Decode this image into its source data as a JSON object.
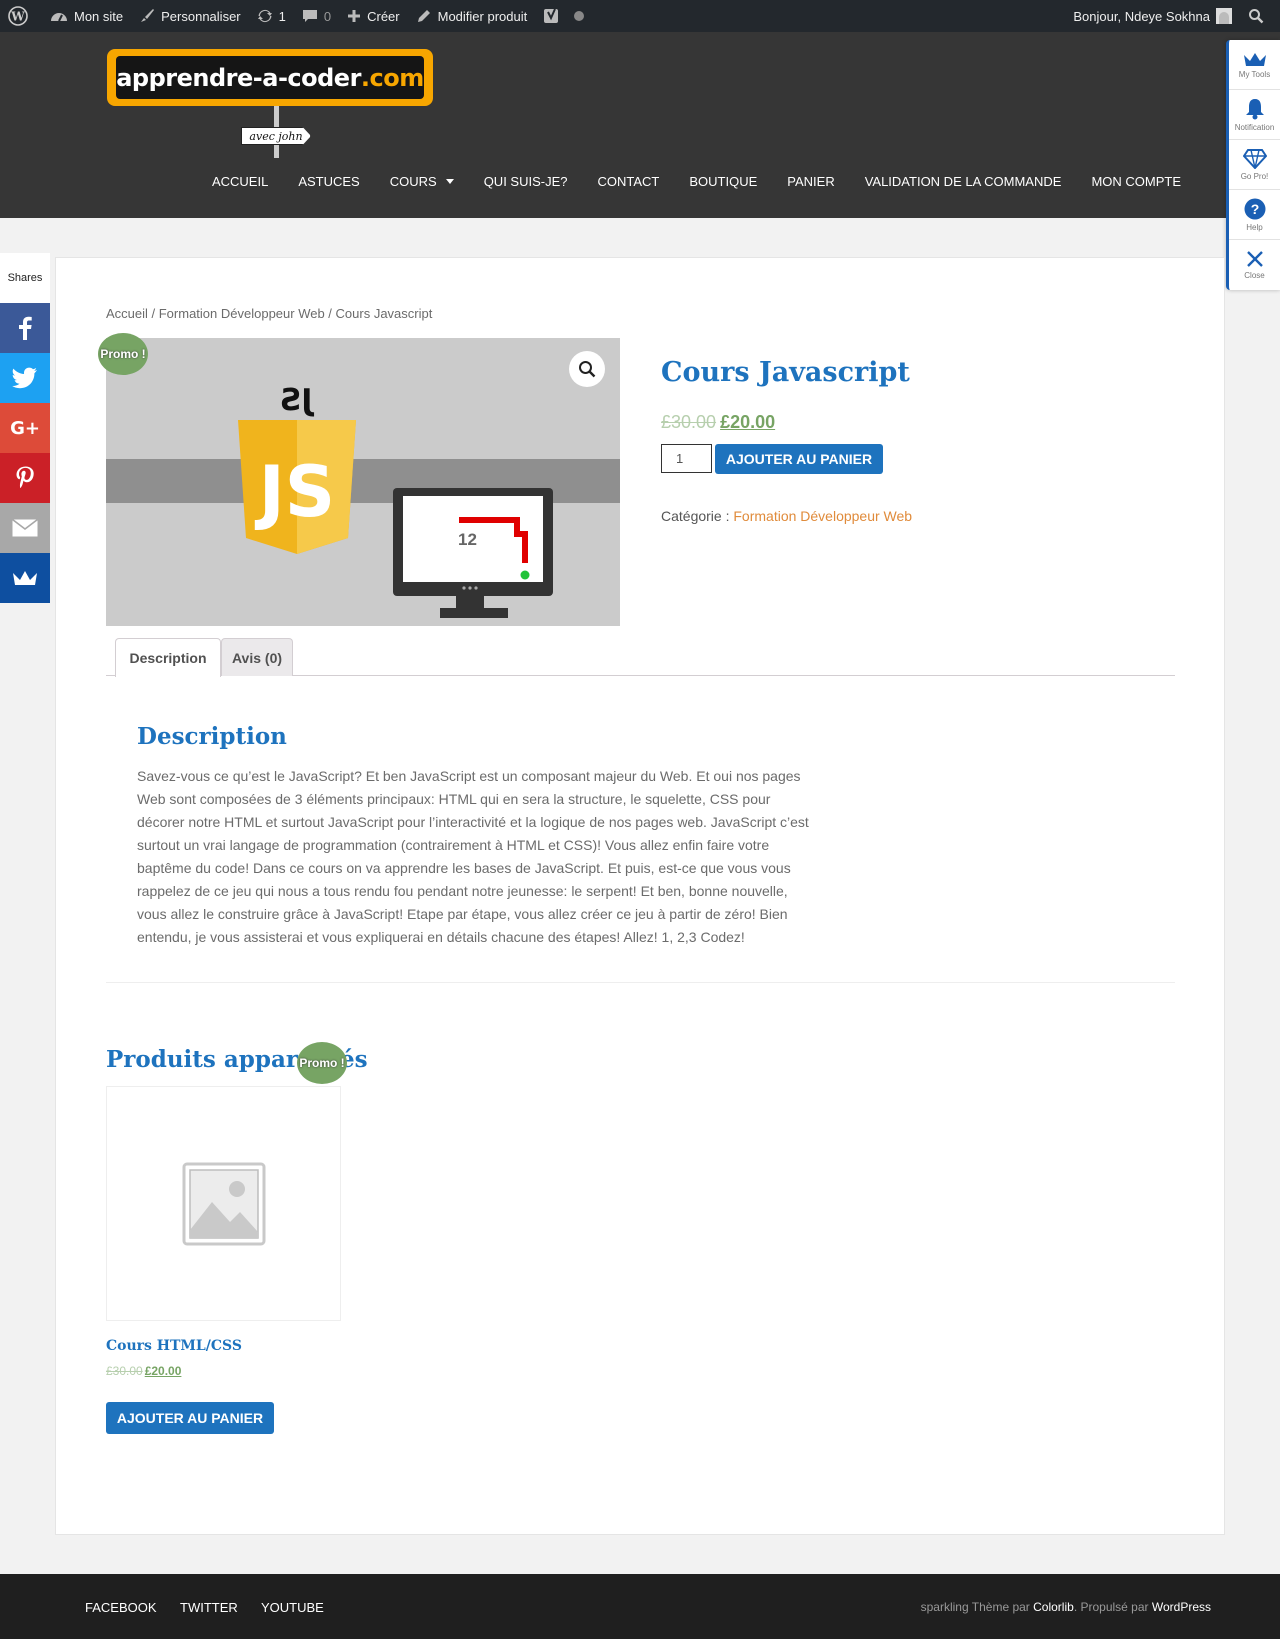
{
  "adminbar": {
    "site": "Mon site",
    "customize": "Personnaliser",
    "updates": "1",
    "comments": "0",
    "create": "Créer",
    "edit": "Modifier produit",
    "greeting": "Bonjour, Ndeye Sokhna"
  },
  "logo": {
    "main": "apprendre-a-coder",
    "tld": ".com",
    "sign": "avec john"
  },
  "nav": [
    "ACCUEIL",
    "ASTUCES",
    "COURS",
    "QUI SUIS-JE?",
    "CONTACT",
    "BOUTIQUE",
    "PANIER",
    "VALIDATION DE LA COMMANDE",
    "MON COMPTE"
  ],
  "tools": [
    "My Tools",
    "Notification",
    "Go Pro!",
    "Help",
    "Close"
  ],
  "share": {
    "label": "Shares",
    "colors": {
      "facebook": "#3b5998",
      "twitter": "#1da1f2",
      "googleplus": "#dd4b39",
      "pinterest": "#cb2027",
      "email": "#a8a8a8",
      "sumo": "#0e4fa0"
    }
  },
  "breadcrumb": "Accueil / Formation Développeur Web / Cours Javascript",
  "product": {
    "badge": "Promo !",
    "title": "Cours Javascript",
    "old_price": "£30.00",
    "new_price": "£20.00",
    "qty": "1",
    "add_to_cart": "AJOUTER AU PANIER",
    "category_label": "Catégorie : ",
    "category": "Formation Développeur Web",
    "image_js_text": "JS",
    "image_score": "12"
  },
  "tabs": {
    "description": "Description",
    "reviews": "Avis (0)"
  },
  "description": {
    "heading": "Description",
    "text": "Savez-vous ce qu’est le JavaScript? Et ben JavaScript est un composant majeur du Web. Et oui nos pages Web sont composées de 3 éléments principaux: HTML qui en sera la structure, le squelette, CSS pour décorer notre HTML et surtout JavaScript pour l’interactivité et la logique de nos pages web. JavaScript c’est surtout un vrai langage de programmation (contrairement à HTML et CSS)! Vous allez enfin faire votre baptême du code! Dans ce cours on va apprendre les bases de JavaScript. Et puis, est-ce que vous vous rappelez de ce jeu qui nous a tous rendu fou pendant notre jeunesse: le serpent! Et ben, bonne nouvelle, vous allez le construire grâce à JavaScript! Etape par étape, vous allez créer ce jeu à partir de zéro! Bien entendu, je vous assisterai et vous expliquerai en détails chacune des étapes! Allez! 1, 2,3 Codez!"
  },
  "related": {
    "heading": "Produits apparentés",
    "badge": "Promo !",
    "title": "Cours HTML/CSS",
    "old_price": "£30.00",
    "new_price": "£20.00",
    "add_to_cart": "AJOUTER AU PANIER"
  },
  "footer": {
    "links": [
      "FACEBOOK",
      "TWITTER",
      "YOUTUBE"
    ],
    "credit_pre": "sparkling Thème par ",
    "credit_colorlib": "Colorlib",
    "credit_mid": ". Propulsé par ",
    "credit_wp": "WordPress"
  },
  "colors": {
    "accent": "#1e73be",
    "promo": "#77a464",
    "header": "#363636",
    "adminbar": "#23282d"
  }
}
